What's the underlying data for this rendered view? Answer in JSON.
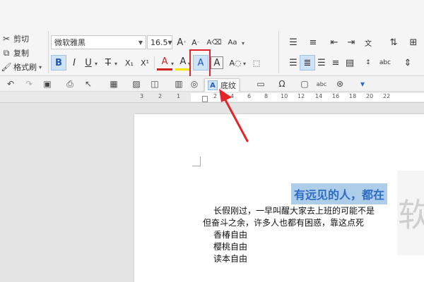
{
  "clipboard": {
    "cut_label": "剪切",
    "copy_label": "复制",
    "format_painter_label": "格式刷"
  },
  "font": {
    "family": "微软雅黑",
    "size": "16.5"
  },
  "formatting": {
    "bold": "B",
    "italic": "I",
    "underline": "U",
    "strikethrough": "T",
    "subscript": "X₁",
    "superscript": "X¹",
    "font_color": "A",
    "highlight": "A",
    "shading": "A",
    "border": "A",
    "grow": "A",
    "shrink": "A"
  },
  "tooltip": {
    "icon": "A",
    "label": "底纹"
  },
  "ruler": {
    "numbers": [
      "3",
      "2",
      "1",
      "2",
      "4",
      "6",
      "8",
      "10",
      "12",
      "14",
      "16",
      "18",
      "20",
      "22"
    ]
  },
  "document": {
    "heading": "有远见的人，都在",
    "lines": [
      "长假刚过，一早叫醒大家去上班的可能不是",
      "但奋斗之余，许多人也都有困惑，靠这点死",
      "香椿自由",
      "樱桃自由",
      "读本自由"
    ],
    "watermark": "软"
  },
  "colors": {
    "accent": "#2c6cc5",
    "highlight_bg": "#aecde8",
    "callout_red": "#e0262b"
  }
}
